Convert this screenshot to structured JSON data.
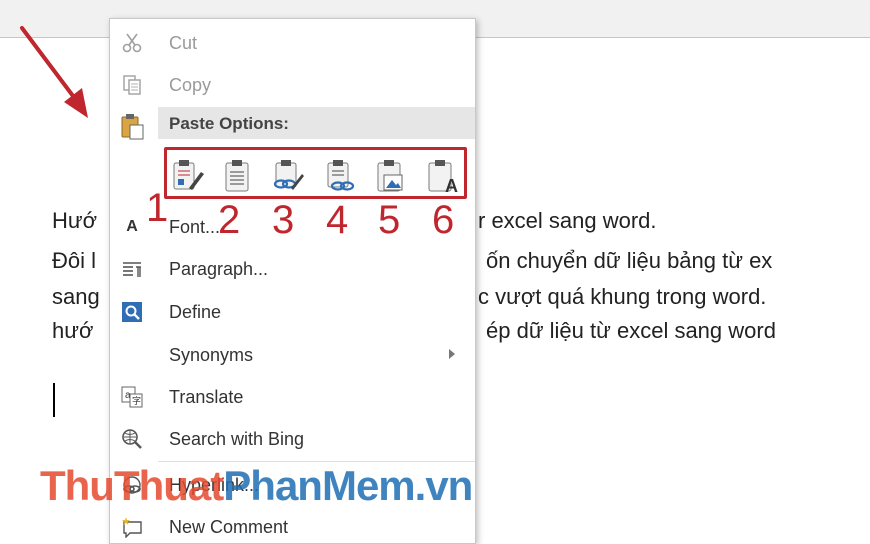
{
  "document": {
    "lines": [
      "Hướng dẫn copy bảng từ excel sang word.",
      "Đôi khi bạn muốn chuyển dữ liệu bảng từ ex",
      "sang word bị các cột vượt quá khung trong word.",
      "hướng dẫn cách copy dán dữ liệu từ excel sang word"
    ],
    "visible_fragments": [
      {
        "left": "Hướ",
        "right": "r excel sang word."
      },
      {
        "left": "Đôi l",
        "right": "ốn chuyển dữ liệu bảng từ ex"
      },
      {
        "left": "sang",
        "right": "c vượt quá khung trong word."
      },
      {
        "left": "hướ",
        "right": "ép dữ liệu từ excel sang word"
      }
    ]
  },
  "context_menu": {
    "cut": "Cut",
    "copy": "Copy",
    "paste_options": "Paste Options:",
    "paste_buttons": [
      {
        "icon": "keep-source-formatting-icon",
        "number": "1"
      },
      {
        "icon": "use-destination-styles-icon",
        "number": "2"
      },
      {
        "icon": "link-keep-source-icon",
        "number": "3"
      },
      {
        "icon": "link-use-destination-icon",
        "number": "4"
      },
      {
        "icon": "paste-picture-icon",
        "number": "5"
      },
      {
        "icon": "keep-text-only-icon",
        "number": "6"
      }
    ],
    "font": "Font...",
    "paragraph": "Paragraph...",
    "define": "Define",
    "synonyms": "Synonyms",
    "translate": "Translate",
    "search": "Search with Bing",
    "hyperlink": "Hyperlink...",
    "new_comment": "New Comment"
  },
  "watermark": {
    "part1": "ThuThuat",
    "part2": "PhanMem.vn"
  },
  "colors": {
    "annotation_red": "#c0262d",
    "menu_border": "#c8c8c8",
    "paste_header_bg": "#e6e6e6"
  }
}
